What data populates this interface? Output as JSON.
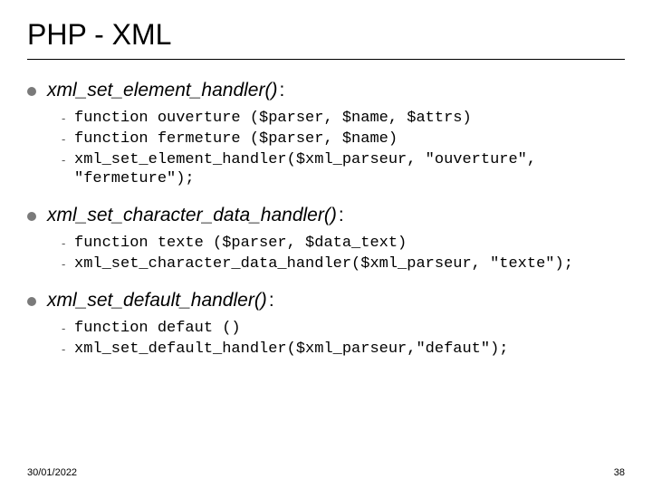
{
  "title": "PHP - XML",
  "sections": [
    {
      "label": "xml_set_element_handler()",
      "items": [
        "function ouverture ($parser, $name, $attrs)",
        "function fermeture ($parser, $name)",
        "xml_set_element_handler($xml_parseur, \"ouverture\", \"fermeture\");"
      ]
    },
    {
      "label": "xml_set_character_data_handler()",
      "items": [
        "function texte ($parser, $data_text)",
        "xml_set_character_data_handler($xml_parseur, \"texte\");"
      ]
    },
    {
      "label": "xml_set_default_handler()",
      "items": [
        "function defaut ()",
        "xml_set_default_handler($xml_parseur,\"defaut\");"
      ]
    }
  ],
  "footer": {
    "date": "30/01/2022",
    "page": "38"
  },
  "colon": " :",
  "dash": "-"
}
